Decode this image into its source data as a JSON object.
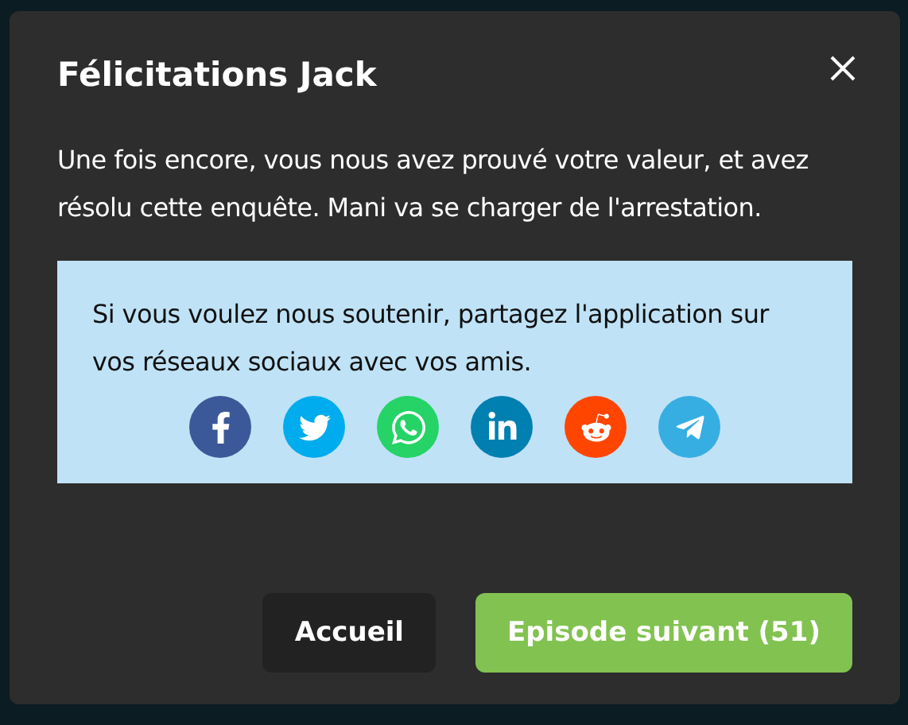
{
  "dialog": {
    "title": "Félicitations Jack",
    "message": "Une fois encore, vous nous avez prouvé votre valeur, et avez résolu cette enquête. Mani va se charger de l'arrestation.",
    "share": {
      "text": "Si vous voulez nous soutenir, partagez l'application sur vos réseaux sociaux avec vos amis.",
      "networks": [
        {
          "kind": "facebook",
          "color": "#3b5998"
        },
        {
          "kind": "twitter",
          "color": "#00aced"
        },
        {
          "kind": "whatsapp",
          "color": "#25d366"
        },
        {
          "kind": "linkedin",
          "color": "#007fb1"
        },
        {
          "kind": "reddit",
          "color": "#ff4500"
        },
        {
          "kind": "telegram",
          "color": "#37aee2"
        }
      ]
    },
    "buttons": [
      {
        "label": "Accueil",
        "kind": "secondary"
      },
      {
        "label": "Episode suivant (51)",
        "kind": "primary"
      }
    ]
  }
}
